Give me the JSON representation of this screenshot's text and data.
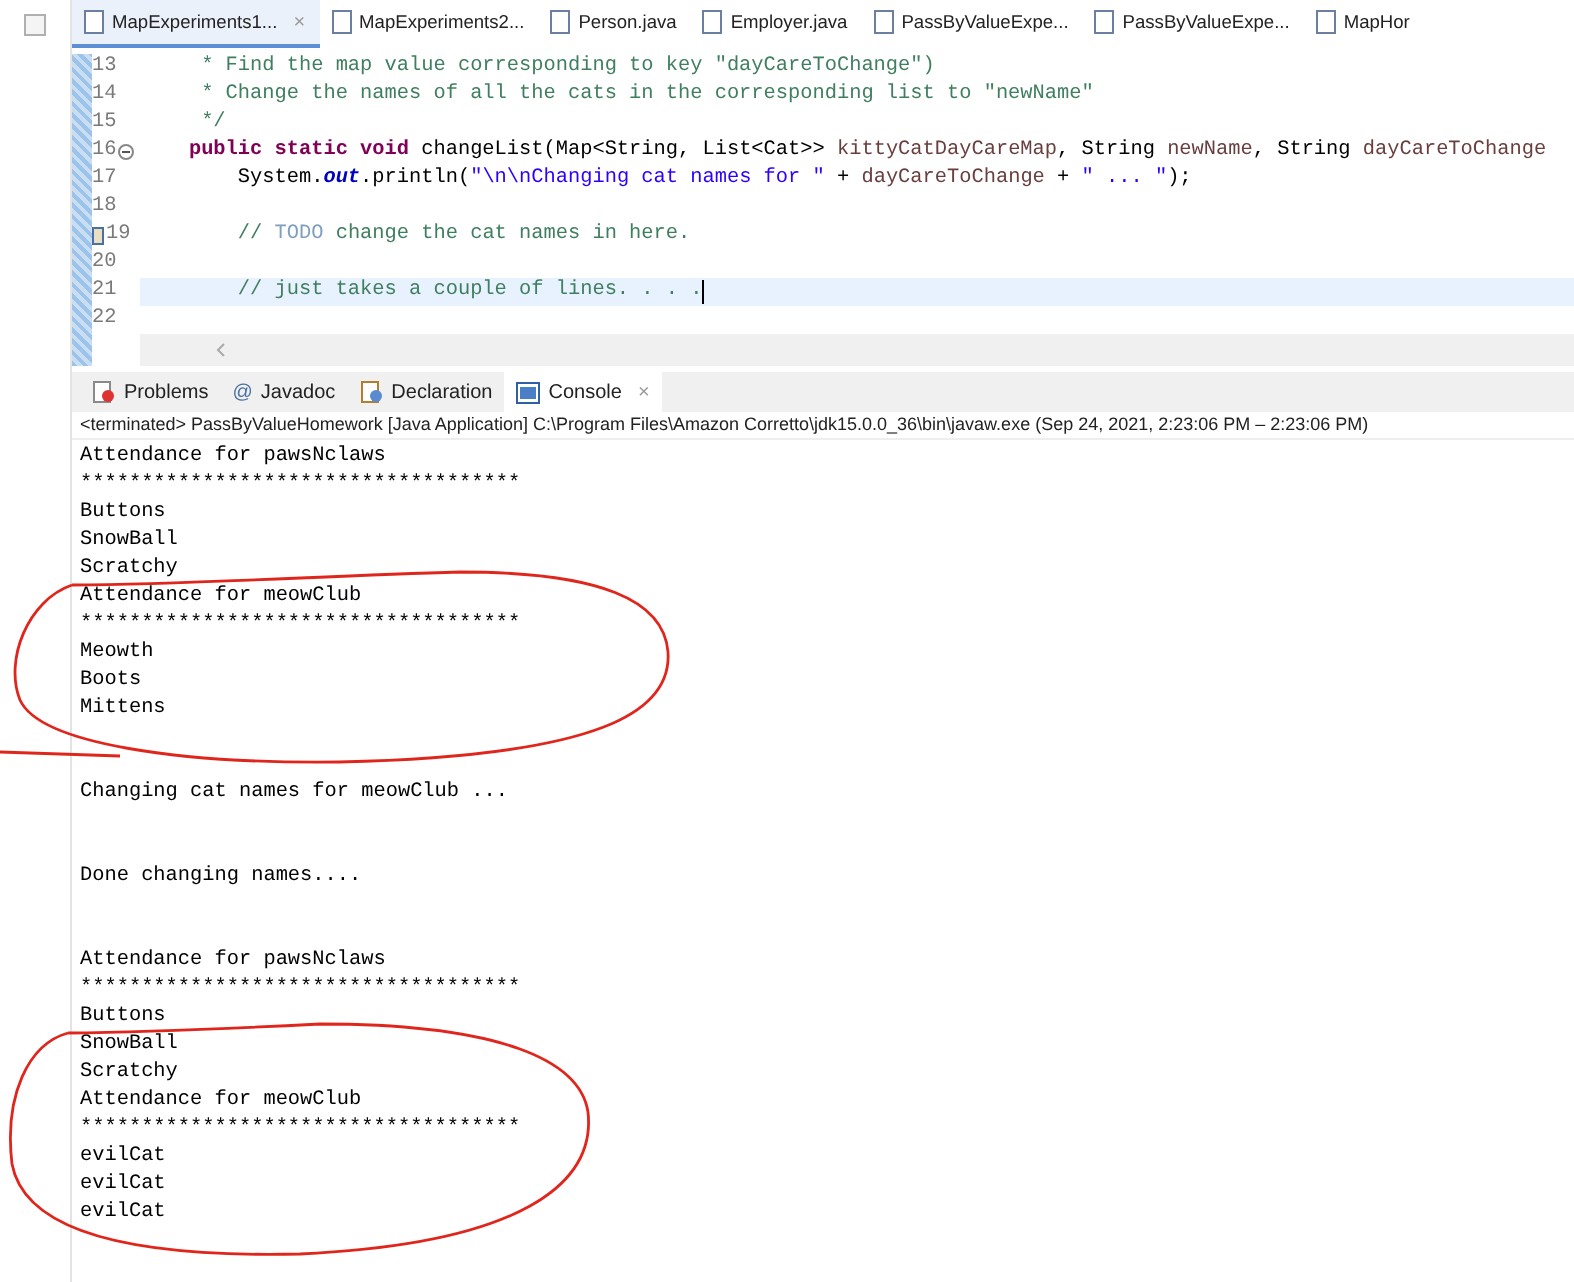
{
  "editor_tabs": [
    {
      "label": "MapExperiments1...",
      "selected": true,
      "close": "×"
    },
    {
      "label": "MapExperiments2...",
      "selected": false
    },
    {
      "label": "Person.java",
      "selected": false
    },
    {
      "label": "Employer.java",
      "selected": false
    },
    {
      "label": "PassByValueExpe...",
      "selected": false
    },
    {
      "label": "PassByValueExpe...",
      "selected": false
    },
    {
      "label": "MapHor",
      "selected": false
    }
  ],
  "code_lines": [
    {
      "number": "13",
      "fold": false,
      "task": false,
      "current": false,
      "segments": [
        {
          "kind": "doc",
          "text": "     * Find the map value corresponding to key \"dayCareToChange\")"
        }
      ]
    },
    {
      "number": "14",
      "fold": false,
      "task": false,
      "current": false,
      "segments": [
        {
          "kind": "doc",
          "text": "     * Change the names of all the cats in the corresponding list to \"newName\""
        }
      ]
    },
    {
      "number": "15",
      "fold": false,
      "task": false,
      "current": false,
      "segments": [
        {
          "kind": "doc",
          "text": "     */"
        }
      ]
    },
    {
      "number": "16",
      "fold": true,
      "task": false,
      "current": false,
      "segments": [
        {
          "kind": "keyword",
          "text": "    public static void"
        },
        {
          "kind": "plain",
          "text": " changeList(Map<String, List<Cat>> "
        },
        {
          "kind": "param",
          "text": "kittyCatDayCareMap"
        },
        {
          "kind": "plain",
          "text": ", String "
        },
        {
          "kind": "param",
          "text": "newName"
        },
        {
          "kind": "plain",
          "text": ", String "
        },
        {
          "kind": "param",
          "text": "dayCareToChange"
        }
      ]
    },
    {
      "number": "17",
      "fold": false,
      "task": false,
      "current": false,
      "segments": [
        {
          "kind": "plain",
          "text": "        System."
        },
        {
          "kind": "field",
          "text": "out"
        },
        {
          "kind": "plain",
          "text": ".println("
        },
        {
          "kind": "string",
          "text": "\"\\n\\nChanging cat names for \""
        },
        {
          "kind": "plain",
          "text": " + "
        },
        {
          "kind": "param",
          "text": "dayCareToChange"
        },
        {
          "kind": "plain",
          "text": " + "
        },
        {
          "kind": "string",
          "text": "\" ... \""
        },
        {
          "kind": "plain",
          "text": ");"
        }
      ]
    },
    {
      "number": "18",
      "fold": false,
      "task": false,
      "current": false
    },
    {
      "number": "19",
      "fold": false,
      "task": true,
      "current": false,
      "segments": [
        {
          "kind": "comment",
          "text": "        // "
        },
        {
          "kind": "todo",
          "text": "TODO"
        },
        {
          "kind": "comment",
          "text": " change the cat names in here."
        }
      ]
    },
    {
      "number": "20",
      "fold": false,
      "task": false,
      "current": false
    },
    {
      "number": "21",
      "fold": false,
      "task": false,
      "current": true,
      "segments": [
        {
          "kind": "comment",
          "text": "        // just takes a couple of lines. . . ."
        }
      ]
    },
    {
      "number": "22",
      "fold": false,
      "task": false,
      "current": false
    }
  ],
  "view_tabs": [
    {
      "label": "Problems",
      "selected": false
    },
    {
      "label": "Javadoc",
      "glyph": "@",
      "selected": false
    },
    {
      "label": "Declaration",
      "selected": false
    },
    {
      "label": "Console",
      "selected": true,
      "close": "×"
    }
  ],
  "console": {
    "status": "<terminated> PassByValueHomework [Java Application] C:\\Program Files\\Amazon Corretto\\jdk15.0.0_36\\bin\\javaw.exe  (Sep 24, 2021, 2:23:06 PM – 2:23:06 PM)",
    "blocks": [
      [
        "Attendance for pawsNclaws",
        "************************************",
        "Buttons",
        "SnowBall",
        "Scratchy",
        "Attendance for meowClub",
        "************************************",
        "Meowth",
        "Boots",
        "Mittens"
      ],
      [
        "Changing cat names for meowClub ..."
      ],
      [
        "Done changing names...."
      ],
      [
        "Attendance for pawsNclaws",
        "************************************",
        "Buttons",
        "SnowBall",
        "Scratchy",
        "Attendance for meowClub",
        "************************************",
        "evilCat",
        "evilCat",
        "evilCat"
      ]
    ]
  }
}
